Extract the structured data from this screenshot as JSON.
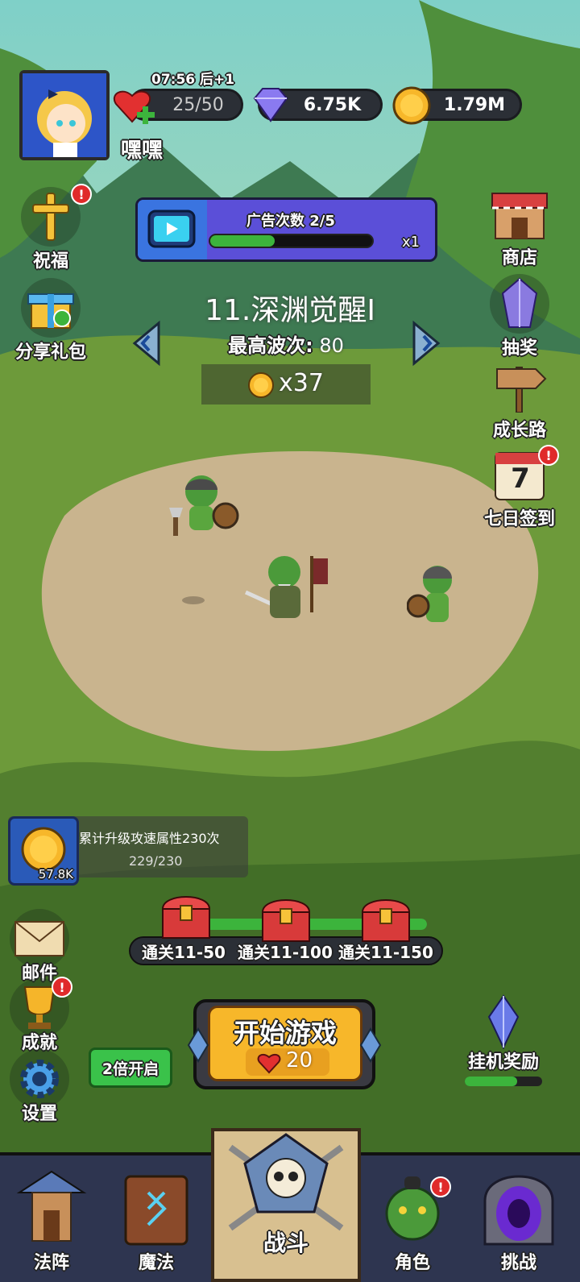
{
  "player": {
    "name": "嘿嘿"
  },
  "resources": {
    "stamina_timer": "07:56 后+1",
    "stamina": "25/50",
    "gems": "6.75K",
    "gold": "1.79M"
  },
  "ad_panel": {
    "label": "广告次数 2/5",
    "multiplier": "x1",
    "progress": 0.4
  },
  "stage": {
    "title": "11.深渊觉醒I",
    "best_wave_label": "最高波次:",
    "best_wave_value": "80",
    "coin_reward": "x37"
  },
  "left_menu": {
    "bless": "祝福",
    "share_gift": "分享礼包",
    "mail": "邮件",
    "achievement": "成就",
    "settings": "设置"
  },
  "right_menu": {
    "shop": "商店",
    "lottery": "抽奖",
    "growth_path": "成长路",
    "seven_day": "七日签到",
    "seven_day_num": "7",
    "idle_reward": "挂机奖励"
  },
  "quest": {
    "text": "累计升级攻速属性230次",
    "progress": "229/230",
    "reward": "57.8K"
  },
  "chests": [
    {
      "label": "通关11-50"
    },
    {
      "label": "通关11-100"
    },
    {
      "label": "通关11-150"
    }
  ],
  "start": {
    "label": "开始游戏",
    "cost": "20",
    "double_btn": "2倍开启"
  },
  "bottom_nav": [
    {
      "label": "法阵"
    },
    {
      "label": "魔法"
    },
    {
      "label": "战斗"
    },
    {
      "label": "角色"
    },
    {
      "label": "挑战"
    }
  ],
  "badge_mark": "!",
  "colors": {
    "sky": "#7cc3c0",
    "grass": "#6d9a3a",
    "dirt": "#c9b48e",
    "accent_gold": "#f7b72a",
    "alert": "#e02a2a"
  }
}
